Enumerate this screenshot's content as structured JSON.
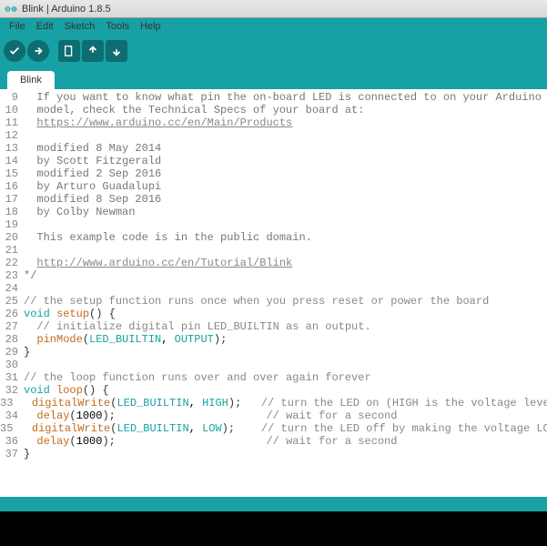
{
  "window": {
    "title": "Blink | Arduino 1.8.5"
  },
  "menu": {
    "file": "File",
    "edit": "Edit",
    "sketch": "Sketch",
    "tools": "Tools",
    "help": "Help"
  },
  "tab": {
    "name": "Blink"
  },
  "code": {
    "lines": [
      {
        "n": 9,
        "type": "doc",
        "text": "  If you want to know what pin the on-board LED is connected to on your Arduino"
      },
      {
        "n": 10,
        "type": "doc",
        "text": "  model, check the Technical Specs of your board at:"
      },
      {
        "n": 11,
        "type": "link",
        "prefix": "  ",
        "text": "https://www.arduino.cc/en/Main/Products"
      },
      {
        "n": 12,
        "type": "blank",
        "text": ""
      },
      {
        "n": 13,
        "type": "doc",
        "text": "  modified 8 May 2014"
      },
      {
        "n": 14,
        "type": "doc",
        "text": "  by Scott Fitzgerald"
      },
      {
        "n": 15,
        "type": "doc",
        "text": "  modified 2 Sep 2016"
      },
      {
        "n": 16,
        "type": "doc",
        "text": "  by Arturo Guadalupi"
      },
      {
        "n": 17,
        "type": "doc",
        "text": "  modified 8 Sep 2016"
      },
      {
        "n": 18,
        "type": "doc",
        "text": "  by Colby Newman"
      },
      {
        "n": 19,
        "type": "blank",
        "text": ""
      },
      {
        "n": 20,
        "type": "doc",
        "text": "  This example code is in the public domain."
      },
      {
        "n": 21,
        "type": "blank",
        "text": ""
      },
      {
        "n": 22,
        "type": "link",
        "prefix": "  ",
        "text": "http://www.arduino.cc/en/Tutorial/Blink"
      },
      {
        "n": 23,
        "type": "doc",
        "text": "*/"
      },
      {
        "n": 24,
        "type": "blank",
        "text": ""
      },
      {
        "n": 25,
        "type": "comment",
        "text": "// the setup function runs once when you press reset or power the board"
      },
      {
        "n": 26,
        "type": "funcdef",
        "kw": "void",
        "name": "setup",
        "rest": "() {"
      },
      {
        "n": 27,
        "type": "comment",
        "text": "  // initialize digital pin LED_BUILTIN as an output."
      },
      {
        "n": 28,
        "type": "call",
        "indent": "  ",
        "fn": "pinMode",
        "args_pre": "(",
        "const1": "LED_BUILTIN",
        "mid": ", ",
        "const2": "OUTPUT",
        "args_post": ");"
      },
      {
        "n": 29,
        "type": "plain",
        "text": "}"
      },
      {
        "n": 30,
        "type": "blank",
        "text": ""
      },
      {
        "n": 31,
        "type": "comment",
        "text": "// the loop function runs over and over again forever"
      },
      {
        "n": 32,
        "type": "funcdef",
        "kw": "void",
        "name": "loop",
        "rest": "() {"
      },
      {
        "n": 33,
        "type": "call2",
        "indent": "  ",
        "fn": "digitalWrite",
        "args_pre": "(",
        "const1": "LED_BUILTIN",
        "mid": ", ",
        "const2": "HIGH",
        "args_post": ");",
        "pad": "   ",
        "trail": "// turn the LED on (HIGH is the voltage level)"
      },
      {
        "n": 34,
        "type": "call1",
        "indent": "  ",
        "fn": "delay",
        "args_pre": "(",
        "val": "1000",
        "args_post": ");",
        "pad": "                       ",
        "trail": "// wait for a second"
      },
      {
        "n": 35,
        "type": "call2",
        "indent": "  ",
        "fn": "digitalWrite",
        "args_pre": "(",
        "const1": "LED_BUILTIN",
        "mid": ", ",
        "const2": "LOW",
        "args_post": ");",
        "pad": "    ",
        "trail": "// turn the LED off by making the voltage LOW"
      },
      {
        "n": 36,
        "type": "call1",
        "indent": "  ",
        "fn": "delay",
        "args_pre": "(",
        "val": "1000",
        "args_post": ");",
        "pad": "                       ",
        "trail": "// wait for a second"
      },
      {
        "n": 37,
        "type": "plain",
        "text": "}"
      }
    ]
  }
}
